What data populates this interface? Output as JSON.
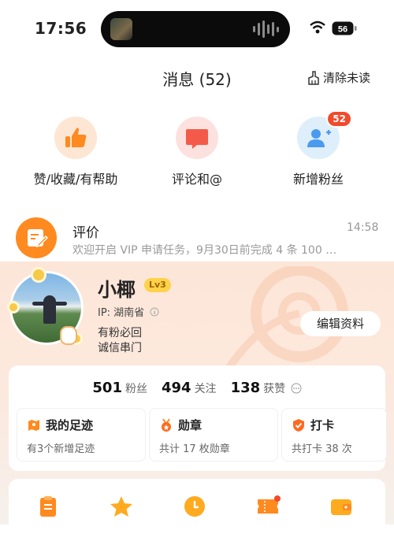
{
  "status_bar": {
    "time": "17:56",
    "battery": "56"
  },
  "header": {
    "title": "消息 (52)",
    "clear_label": "清除未读"
  },
  "categories": [
    {
      "label": "赞/收藏/有帮助",
      "icon": "thumbs-up-icon"
    },
    {
      "label": "评论和@",
      "icon": "comment-icon"
    },
    {
      "label": "新增粉丝",
      "icon": "add-user-icon",
      "badge": "52"
    }
  ],
  "message": {
    "title": "评价",
    "time": "14:58",
    "text": "欢迎开启 VIP 申请任务，9月30日前完成 4 条 100 …"
  },
  "profile": {
    "name": "小椰",
    "level": "Lv3",
    "ip": "IP: 湖南省",
    "bio_line1": "有粉必回",
    "bio_line2": "诚信串门",
    "edit_label": "编辑资料"
  },
  "stats": {
    "fans_count": "501",
    "fans_label": "粉丝",
    "follow_count": "494",
    "follow_label": "关注",
    "likes_count": "138",
    "likes_label": "获赞"
  },
  "subcards": [
    {
      "title": "我的足迹",
      "desc": "有3个新增足迹",
      "icon": "map-icon"
    },
    {
      "title": "勋章",
      "desc": "共计 17 枚勋章",
      "icon": "medal-icon"
    },
    {
      "title": "打卡",
      "desc": "共打卡 38 次",
      "icon": "checkin-icon"
    }
  ],
  "tools": [
    "clipboard-icon",
    "star-icon",
    "clock-icon",
    "ticket-icon",
    "wallet-icon"
  ],
  "colors": {
    "accent": "#ff8a1f",
    "badge": "#f24a2c",
    "level": "#ffd24a"
  }
}
